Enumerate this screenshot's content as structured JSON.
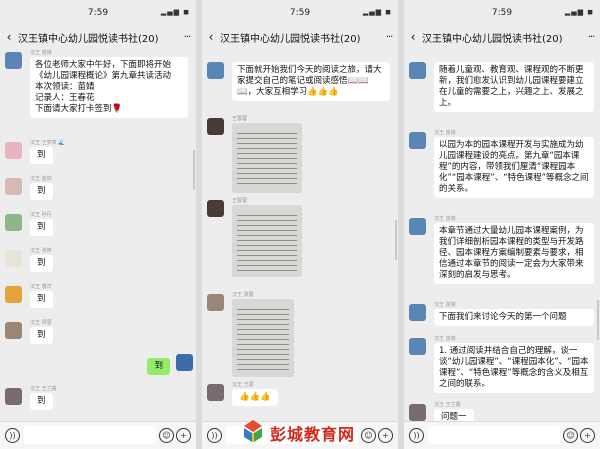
{
  "status_time": "7:59",
  "chat_title": "汉王镇中心幼儿园悦读书社(20)",
  "colors": {
    "bubble_self": "#95ec69",
    "bubble_other": "#ffffff",
    "background": "#ededed",
    "watermark": "#d4281c"
  },
  "icons": [
    "back-icon",
    "more-icon",
    "voice-icon",
    "emoji-icon",
    "plus-icon"
  ],
  "panel1": {
    "messages": [
      {
        "sender": "汉王 苗婧",
        "text": "各位老师大家中午好，下面即将开始《幼儿园课程概论》第九章共读活动\n本次领读：苗婧\n记录人：王春花\n下面请大家打卡签到🌹"
      },
      {
        "sender": "汉王 王梦真 🌊",
        "text": "到"
      },
      {
        "sender": "汉王 蓝如",
        "text": "到"
      },
      {
        "sender": "汉王 孙丹",
        "text": "到"
      },
      {
        "sender": "汉王 张婷",
        "text": "到"
      },
      {
        "sender": "汉王 唐洋",
        "text": "到"
      },
      {
        "sender": "汉王 梁蓉",
        "text": "到"
      },
      {
        "sender": "",
        "text": "到",
        "self": true
      },
      {
        "sender": "汉王 王兰鑫",
        "text": "到"
      }
    ]
  },
  "panel2": {
    "messages": [
      {
        "sender": "",
        "text": "下面就开始我们今天的阅读之旅，请大家提交自己的笔记或阅读感悟📖📖📖，大家互相学习👍👍👍"
      },
      {
        "sender": "王蓉蓉",
        "type": "image"
      },
      {
        "sender": "王蓉蓉",
        "type": "image"
      },
      {
        "sender": "汉王 梁蓉",
        "type": "image"
      },
      {
        "sender": "汉王 王蓉",
        "text": "👍👍👍"
      }
    ]
  },
  "panel3": {
    "messages": [
      {
        "sender": "",
        "text": "随着儿童观、教育观、课程观的不断更新，我们愈发认识到幼儿园课程要建立在儿童的需要之上，兴趣之上、发展之上。"
      },
      {
        "sender": "汉王 苗婧",
        "text": "以园为本的园本课程开发与实施成为幼儿园课程建设的亮点。第九章“园本课程”的内容，带领我们厘清“课程园本化”“园本课程”、“特色课程”等概念之间的关系。"
      },
      {
        "sender": "汉王 苗婧",
        "text": "本章节通过大量幼儿园本课程案例，为我们详细剖析园本课程的类型与开发路径、园本课程方案编制要素与要求，相信通过本章节的阅读一定会为大家带来深刻的启发与思考。"
      },
      {
        "sender": "汉王 苗婧",
        "text": "下面我们来讨论今天的第一个问题"
      },
      {
        "sender": "汉王 苗婧",
        "text": "1. 通过阅读并结合自己的理解，谈一谈“幼儿园课程”、“课程园本化”、“园本课程”、“特色课程”等概念的含义及相互之间的联系。"
      },
      {
        "sender": "汉王 王兰鑫",
        "text": "问题一"
      }
    ]
  },
  "watermark": {
    "text": "彭城教育网"
  }
}
